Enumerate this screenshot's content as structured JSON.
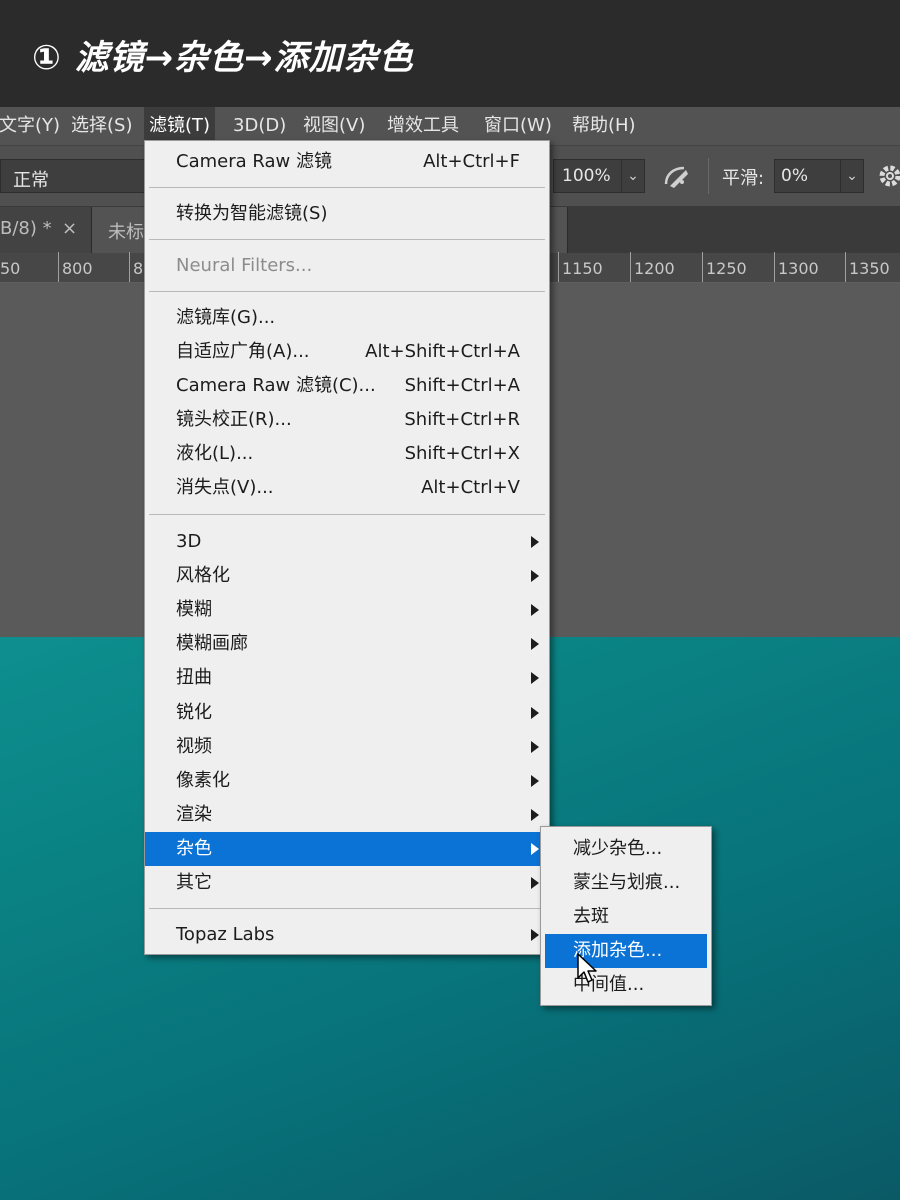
{
  "banner": {
    "caption": "① 滤镜→杂色→添加杂色"
  },
  "menubar": {
    "items": [
      "文字(Y)",
      "选择(S)",
      "滤镜(T)",
      "3D(D)",
      "视图(V)",
      "增效工具",
      "窗口(W)",
      "帮助(H)"
    ],
    "active": "滤镜(T)"
  },
  "options": {
    "mode": "正常",
    "opacity": "100%",
    "smooth_label": "平滑:",
    "smooth_value": "0%"
  },
  "tabs": [
    {
      "label": "B/8) *",
      "close": "×"
    },
    {
      "label": "未标"
    }
  ],
  "ruler": {
    "left_labels": [
      "50",
      "800",
      "8"
    ],
    "right_labels": [
      "1150",
      "1200",
      "1250",
      "1300",
      "1350"
    ]
  },
  "filter_menu": {
    "camera_raw_top": {
      "label": "Camera Raw 滤镜",
      "shortcut": "Alt+Ctrl+F"
    },
    "convert_smart": {
      "label": "转换为智能滤镜(S)"
    },
    "neural_filters": {
      "label": "Neural Filters..."
    },
    "filter_gallery": {
      "label": "滤镜库(G)..."
    },
    "adaptive_wide": {
      "label": "自适应广角(A)...",
      "shortcut": "Alt+Shift+Ctrl+A"
    },
    "camera_raw": {
      "label": "Camera Raw 滤镜(C)...",
      "shortcut": "Shift+Ctrl+A"
    },
    "lens_correction": {
      "label": "镜头校正(R)...",
      "shortcut": "Shift+Ctrl+R"
    },
    "liquify": {
      "label": "液化(L)...",
      "shortcut": "Shift+Ctrl+X"
    },
    "vanishing_point": {
      "label": "消失点(V)...",
      "shortcut": "Alt+Ctrl+V"
    },
    "submenus": [
      "3D",
      "风格化",
      "模糊",
      "模糊画廊",
      "扭曲",
      "锐化",
      "视频",
      "像素化",
      "渲染",
      "杂色",
      "其它"
    ],
    "topaz": {
      "label": "Topaz Labs"
    },
    "highlighted": "杂色"
  },
  "noise_submenu": {
    "items": [
      "减少杂色...",
      "蒙尘与划痕...",
      "去斑",
      "添加杂色...",
      "中间值..."
    ],
    "highlighted": "添加杂色..."
  },
  "colors": {
    "highlight": "#0b72d6",
    "canvas_teal": "#0a8183",
    "menu_bg": "#efefef"
  }
}
